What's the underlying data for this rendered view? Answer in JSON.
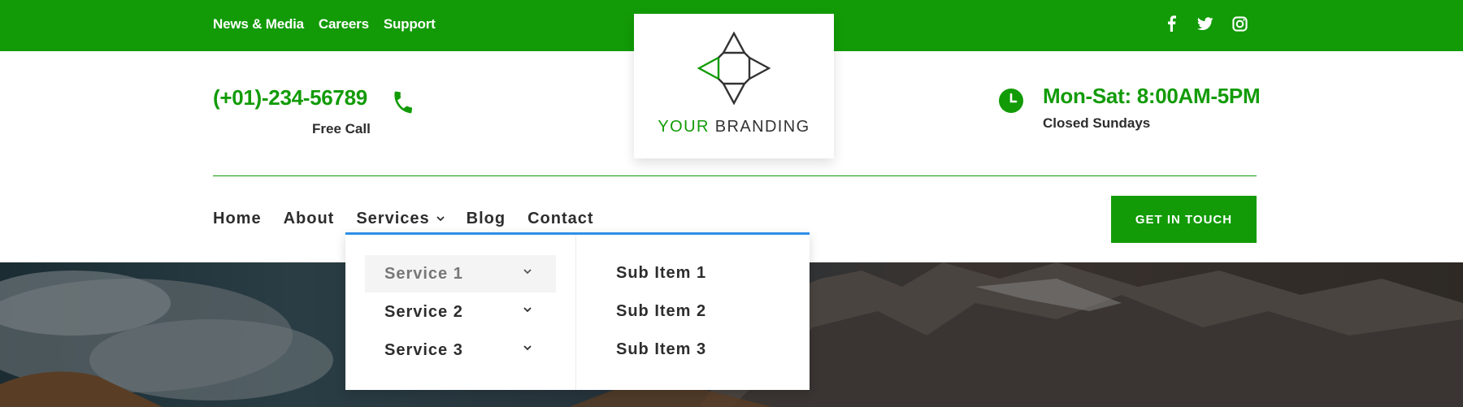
{
  "topbar": {
    "links": [
      "News & Media",
      "Careers",
      "Support"
    ],
    "social_icons": [
      "facebook-icon",
      "twitter-icon",
      "instagram-icon"
    ]
  },
  "brand": {
    "highlight": "YOUR",
    "rest": "BRANDING",
    "icon": "diamond-arrows-logo"
  },
  "contact": {
    "phone": "(+01)-234-56789",
    "phone_sub": "Free Call",
    "phone_icon": "phone-icon"
  },
  "hours": {
    "title": "Mon-Sat: 8:00AM-5PM",
    "sub": "Closed Sundays",
    "icon": "clock-icon"
  },
  "nav": {
    "items": [
      "Home",
      "About",
      "Services",
      "Blog",
      "Contact"
    ],
    "cta": "GET IN TOUCH"
  },
  "dropdown": {
    "services": [
      "Service 1",
      "Service 2",
      "Service 3"
    ],
    "sub_items": [
      "Sub Item 1",
      "Sub Item 2",
      "Sub Item 3"
    ]
  },
  "colors": {
    "primary": "#129b07",
    "dropdown_accent": "#2e8fe8",
    "text": "#2d2d2d"
  }
}
